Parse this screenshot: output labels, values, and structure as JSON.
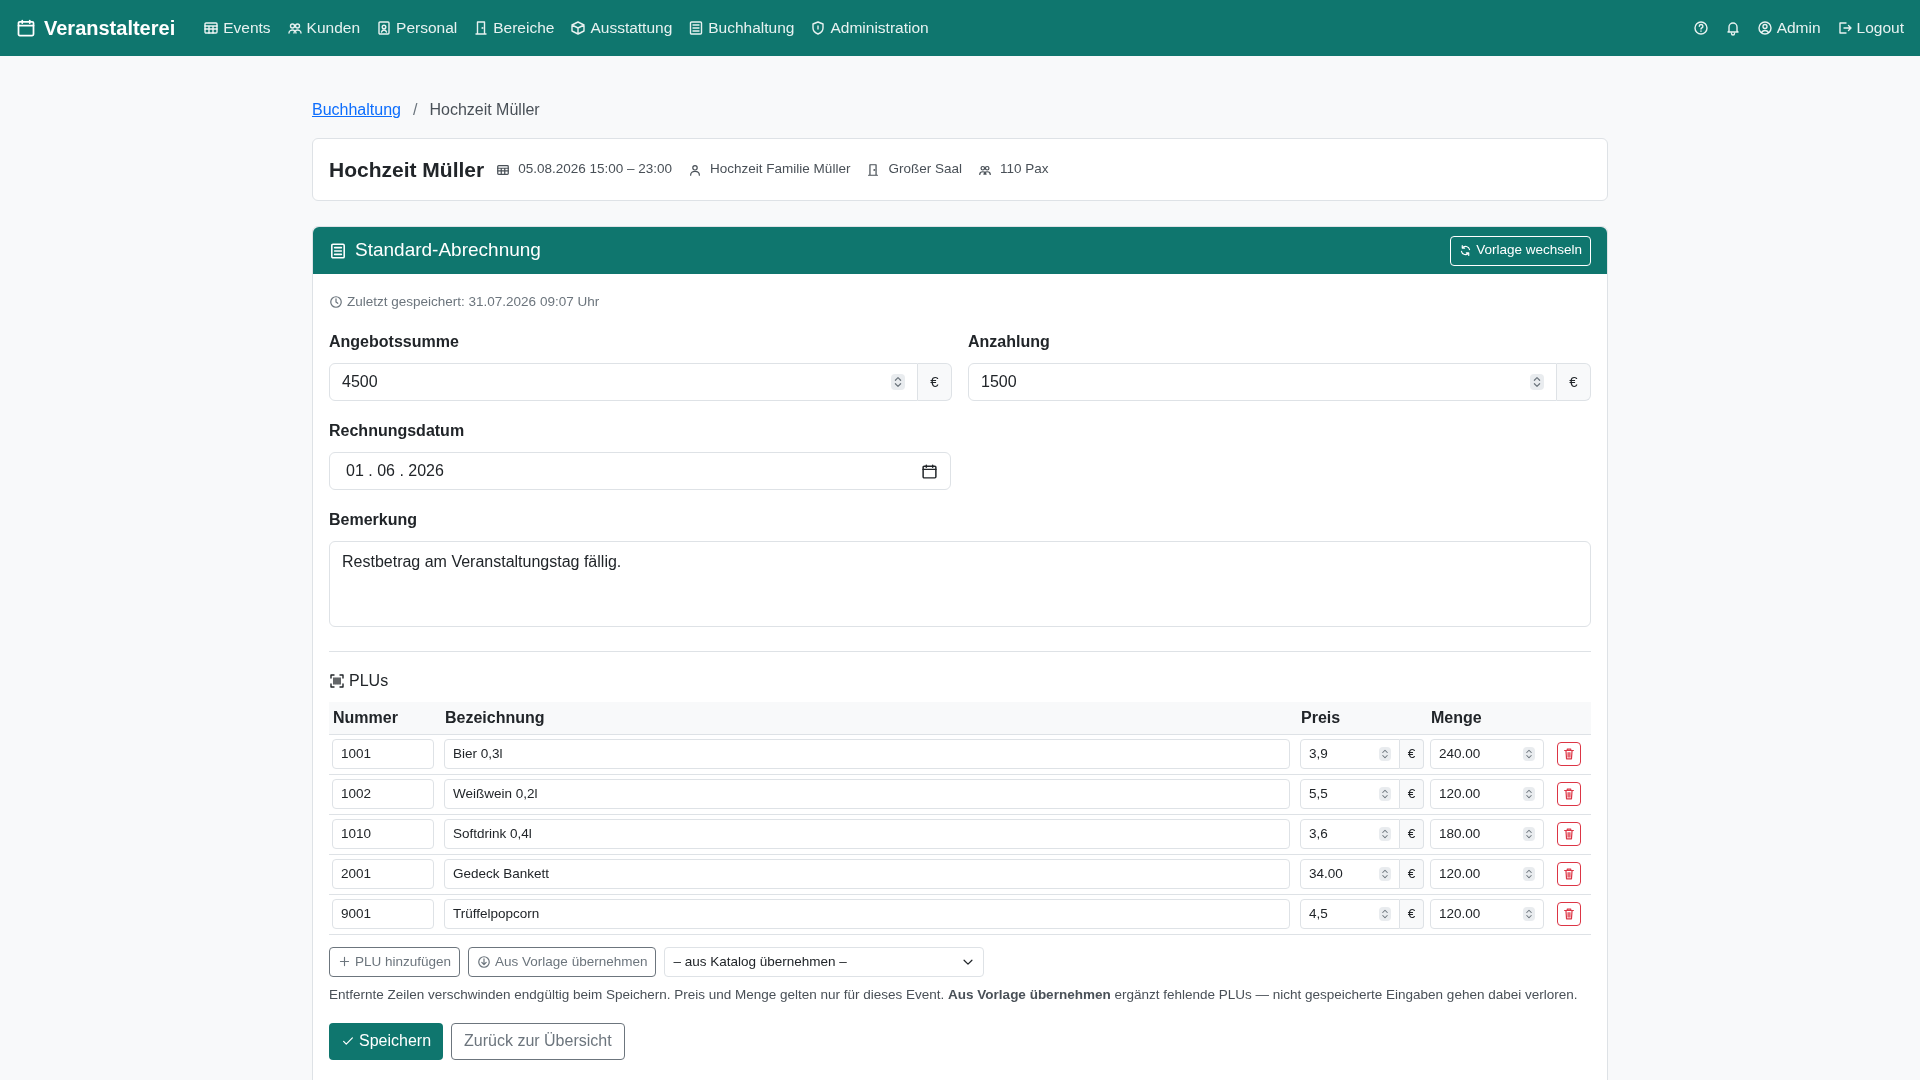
{
  "navbar": {
    "brand": "Veranstalterei",
    "items": [
      {
        "label": "Events"
      },
      {
        "label": "Kunden"
      },
      {
        "label": "Personal"
      },
      {
        "label": "Bereiche"
      },
      {
        "label": "Ausstattung"
      },
      {
        "label": "Buchhaltung"
      },
      {
        "label": "Administration"
      }
    ],
    "user": "Admin",
    "logout": "Logout"
  },
  "breadcrumb": {
    "link": "Buchhaltung",
    "separator": "/",
    "current": "Hochzeit Müller"
  },
  "event": {
    "title": "Hochzeit Müller",
    "date": "05.08.2026 15:00 – 23:00",
    "customer": "Hochzeit Familie Müller",
    "room": "Großer Saal",
    "guests": "110 Pax"
  },
  "billing": {
    "title": "Standard-Abrechnung",
    "switch_button": "Vorlage wechseln",
    "saved": "Zuletzt gespeichert: 31.07.2026 09:07 Uhr",
    "offer_label": "Angebotssumme",
    "offer_value": "4500",
    "deposit_label": "Anzahlung",
    "deposit_value": "1500",
    "currency": "€",
    "date_label": "Rechnungsdatum",
    "date_value": "01 . 06 . 2026",
    "remark_label": "Bemerkung",
    "remark_value": "Restbetrag am Veranstaltungstag fällig."
  },
  "plus": {
    "title": "PLUs",
    "columns": [
      "Nummer",
      "Bezeichnung",
      "Preis",
      "Menge"
    ],
    "rows": [
      {
        "number": "1001",
        "name": "Bier 0,3l",
        "price": "3,9",
        "currency": "€",
        "quantity": "240.00"
      },
      {
        "number": "1002",
        "name": "Weißwein 0,2l",
        "price": "5,5",
        "currency": "€",
        "quantity": "120.00"
      },
      {
        "number": "1010",
        "name": "Softdrink 0,4l",
        "price": "3,6",
        "currency": "€",
        "quantity": "180.00"
      },
      {
        "number": "2001",
        "name": "Gedeck Bankett",
        "price": "34.00",
        "currency": "€",
        "quantity": "120.00"
      },
      {
        "number": "9001",
        "name": "Trüffelpopcorn",
        "price": "4,5",
        "currency": "€",
        "quantity": "120.00"
      }
    ],
    "add_button": "PLU hinzufügen",
    "template_button": "Aus Vorlage übernehmen",
    "catalog_select": "– aus Katalog übernehmen –",
    "help": "Entfernte Zeilen verschwinden endgültig beim Speichern. Preis und Menge gelten nur für dieses Event. **Aus Vorlage übernehmen** ergänzt fehlende PLUs — nicht gespeicherte Eingaben gehen dabei verloren."
  },
  "actions": {
    "save": "Speichern",
    "back": "Zurück zur Übersicht"
  }
}
